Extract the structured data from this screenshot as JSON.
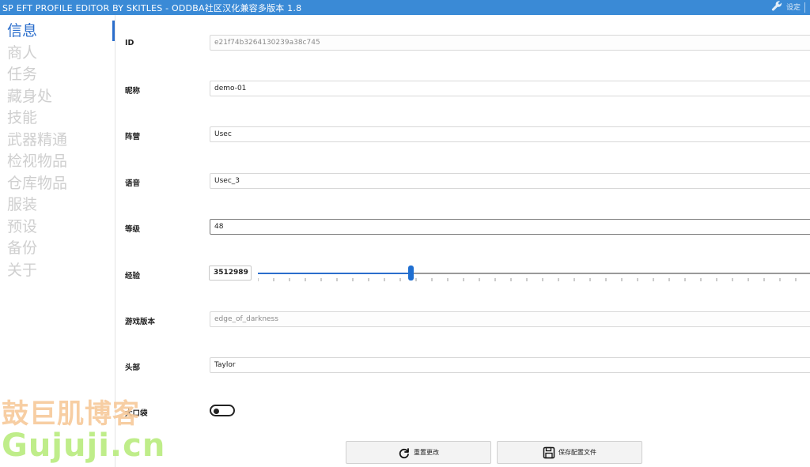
{
  "window": {
    "title": "SP EFT PROFILE EDITOR BY SKITLES - ODDBA社区汉化兼容多版本 1.8",
    "settings_label": "设定",
    "settings_icon": "wrench-icon"
  },
  "sidebar": {
    "items": [
      {
        "label": "信息",
        "active": true
      },
      {
        "label": "商人"
      },
      {
        "label": "任务"
      },
      {
        "label": "藏身处"
      },
      {
        "label": "技能"
      },
      {
        "label": "武器精通"
      },
      {
        "label": "检视物品"
      },
      {
        "label": "仓库物品"
      },
      {
        "label": "服装"
      },
      {
        "label": "预设"
      },
      {
        "label": "备份"
      },
      {
        "label": "关于"
      }
    ]
  },
  "form": {
    "id": {
      "label": "ID",
      "value": "e21f74b3264130239a38c745"
    },
    "nickname": {
      "label": "昵称",
      "value": "demo-01"
    },
    "faction": {
      "label": "阵营",
      "value": "Usec"
    },
    "voice": {
      "label": "语音",
      "value": "Usec_3"
    },
    "level": {
      "label": "等级",
      "value": "48"
    },
    "experience": {
      "label": "经验",
      "value": "3512989",
      "slider_fraction": 0.276
    },
    "game_version": {
      "label": "游戏版本",
      "value": "edge_of_darkness"
    },
    "head": {
      "label": "头部",
      "value": "Taylor"
    },
    "big_pockets": {
      "label": "大口袋",
      "on": false
    }
  },
  "buttons": {
    "reset": {
      "label": "重置更改",
      "icon": "redo-icon"
    },
    "save": {
      "label": "保存配置文件",
      "icon": "floppy-disk-icon"
    }
  },
  "watermark": {
    "line1": "鼓巨肌博客",
    "line2": "Gujuji.cn"
  },
  "colors": {
    "titlebar": "#3a8ad6",
    "accent": "#2b6ecc",
    "nav_inactive": "#cfcfcf"
  }
}
